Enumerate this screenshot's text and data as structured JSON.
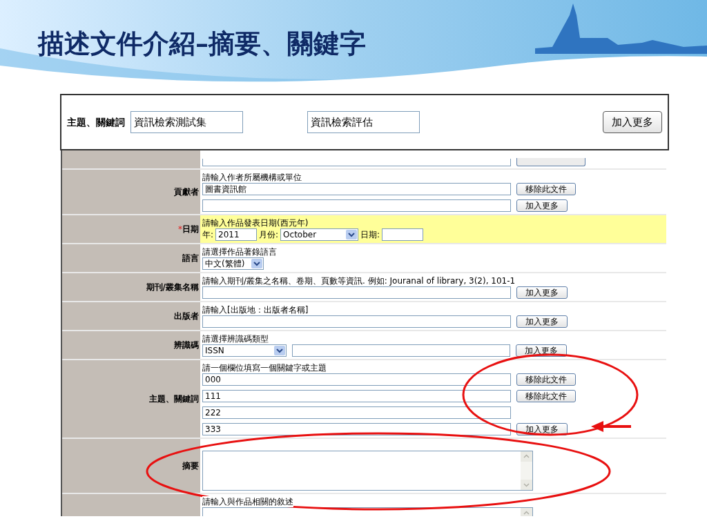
{
  "slide_title": "描述文件介紹–摘要、關鍵字",
  "overlay": {
    "label": "主題、關鍵詞",
    "values": [
      "資訊檢索測試集",
      "資訊檢索評估"
    ],
    "button": "加入更多"
  },
  "rows": [
    {
      "kind": "partial"
    },
    {
      "kind": "inputs",
      "label": "貢獻者",
      "hint": "請輸入作者所屬機構或單位",
      "fields": [
        {
          "value": "圖書資訊館",
          "button": "移除此文件"
        },
        {
          "button": "加入更多"
        }
      ]
    },
    {
      "kind": "date",
      "label": "日期",
      "required": true,
      "required_mark": "*",
      "hint": "請輸入作品發表日期(西元年)",
      "year_label": "年:",
      "year": "2011",
      "month_label": "月份:",
      "month": "October",
      "day_label": "日期:"
    },
    {
      "kind": "select",
      "label": "語言",
      "hint": "請選擇作品著錄語言",
      "value": "中文(繁體)"
    },
    {
      "kind": "inputs",
      "label": "期刊/叢集名稱",
      "hint": "請輸入期刊/叢集之名稱、卷期、頁數等資訊. 例如: Jouranal of library, 3(2), 101-1",
      "fields": [
        {
          "button": "加入更多"
        }
      ]
    },
    {
      "kind": "inputs",
      "label": "出版者",
      "hint": "請輸入[出版地：出版者名稱]",
      "fields": [
        {
          "button": "加入更多"
        }
      ]
    },
    {
      "kind": "id",
      "label": "辨識碼",
      "hint": "請選擇辨識碼類型",
      "value": "ISSN",
      "button": "加入更多"
    },
    {
      "kind": "inputs",
      "label": "主題、關鍵詞",
      "hint": "請一個欄位填寫一個關鍵字或主題",
      "fields": [
        {
          "value": "000",
          "button": "移除此文件"
        },
        {
          "value": "111",
          "button": "移除此文件"
        },
        {
          "value": "222"
        },
        {
          "value": "333",
          "button": "加入更多"
        }
      ]
    },
    {
      "kind": "textarea",
      "label": "摘要"
    },
    {
      "kind": "textarea",
      "hint": "請輸入與作品相關的敘述",
      "cut_off": true
    }
  ]
}
